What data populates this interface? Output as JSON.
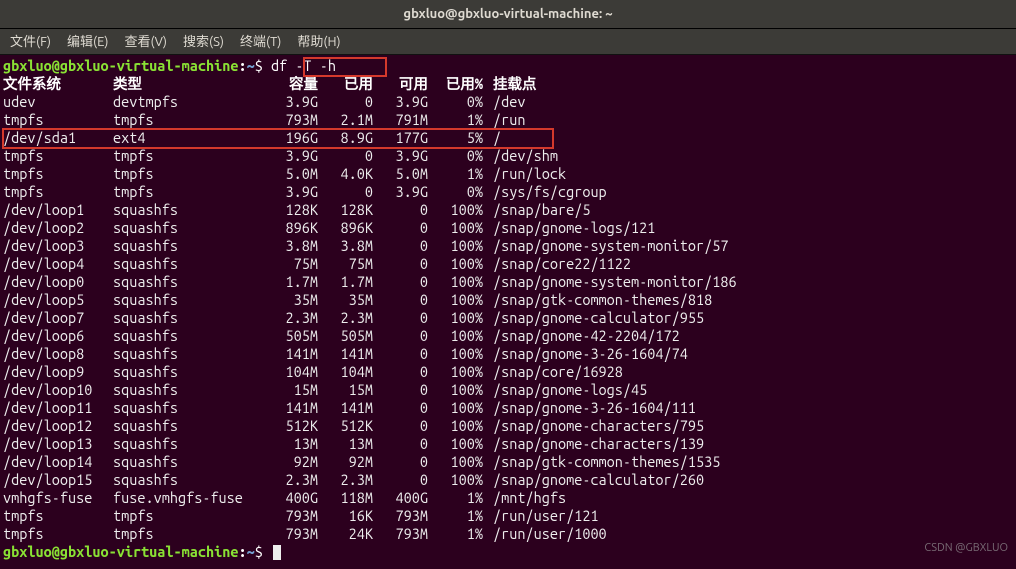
{
  "title": "gbxluo@gbxluo-virtual-machine: ~",
  "menu": [
    "文件(F)",
    "编辑(E)",
    "查看(V)",
    "搜索(S)",
    "终端(T)",
    "帮助(H)"
  ],
  "prompt": {
    "user": "gbxluo",
    "host": "gbxluo-virtual-machine",
    "path": "~",
    "symbol": "$"
  },
  "command": "df -T -h",
  "headers": {
    "fs": "文件系统",
    "type": "类型",
    "size": "容量",
    "used": "已用",
    "avail": "可用",
    "pct": "已用%",
    "mnt": "挂载点"
  },
  "rows": [
    {
      "fs": "udev",
      "type": "devtmpfs",
      "size": "3.9G",
      "used": "0",
      "avail": "3.9G",
      "pct": "0%",
      "mnt": "/dev"
    },
    {
      "fs": "tmpfs",
      "type": "tmpfs",
      "size": "793M",
      "used": "2.1M",
      "avail": "791M",
      "pct": "1%",
      "mnt": "/run"
    },
    {
      "fs": "/dev/sda1",
      "type": "ext4",
      "size": "196G",
      "used": "8.9G",
      "avail": "177G",
      "pct": "5%",
      "mnt": "/"
    },
    {
      "fs": "tmpfs",
      "type": "tmpfs",
      "size": "3.9G",
      "used": "0",
      "avail": "3.9G",
      "pct": "0%",
      "mnt": "/dev/shm"
    },
    {
      "fs": "tmpfs",
      "type": "tmpfs",
      "size": "5.0M",
      "used": "4.0K",
      "avail": "5.0M",
      "pct": "1%",
      "mnt": "/run/lock"
    },
    {
      "fs": "tmpfs",
      "type": "tmpfs",
      "size": "3.9G",
      "used": "0",
      "avail": "3.9G",
      "pct": "0%",
      "mnt": "/sys/fs/cgroup"
    },
    {
      "fs": "/dev/loop1",
      "type": "squashfs",
      "size": "128K",
      "used": "128K",
      "avail": "0",
      "pct": "100%",
      "mnt": "/snap/bare/5"
    },
    {
      "fs": "/dev/loop2",
      "type": "squashfs",
      "size": "896K",
      "used": "896K",
      "avail": "0",
      "pct": "100%",
      "mnt": "/snap/gnome-logs/121"
    },
    {
      "fs": "/dev/loop3",
      "type": "squashfs",
      "size": "3.8M",
      "used": "3.8M",
      "avail": "0",
      "pct": "100%",
      "mnt": "/snap/gnome-system-monitor/57"
    },
    {
      "fs": "/dev/loop4",
      "type": "squashfs",
      "size": "75M",
      "used": "75M",
      "avail": "0",
      "pct": "100%",
      "mnt": "/snap/core22/1122"
    },
    {
      "fs": "/dev/loop0",
      "type": "squashfs",
      "size": "1.7M",
      "used": "1.7M",
      "avail": "0",
      "pct": "100%",
      "mnt": "/snap/gnome-system-monitor/186"
    },
    {
      "fs": "/dev/loop5",
      "type": "squashfs",
      "size": "35M",
      "used": "35M",
      "avail": "0",
      "pct": "100%",
      "mnt": "/snap/gtk-common-themes/818"
    },
    {
      "fs": "/dev/loop7",
      "type": "squashfs",
      "size": "2.3M",
      "used": "2.3M",
      "avail": "0",
      "pct": "100%",
      "mnt": "/snap/gnome-calculator/955"
    },
    {
      "fs": "/dev/loop6",
      "type": "squashfs",
      "size": "505M",
      "used": "505M",
      "avail": "0",
      "pct": "100%",
      "mnt": "/snap/gnome-42-2204/172"
    },
    {
      "fs": "/dev/loop8",
      "type": "squashfs",
      "size": "141M",
      "used": "141M",
      "avail": "0",
      "pct": "100%",
      "mnt": "/snap/gnome-3-26-1604/74"
    },
    {
      "fs": "/dev/loop9",
      "type": "squashfs",
      "size": "104M",
      "used": "104M",
      "avail": "0",
      "pct": "100%",
      "mnt": "/snap/core/16928"
    },
    {
      "fs": "/dev/loop10",
      "type": "squashfs",
      "size": "15M",
      "used": "15M",
      "avail": "0",
      "pct": "100%",
      "mnt": "/snap/gnome-logs/45"
    },
    {
      "fs": "/dev/loop11",
      "type": "squashfs",
      "size": "141M",
      "used": "141M",
      "avail": "0",
      "pct": "100%",
      "mnt": "/snap/gnome-3-26-1604/111"
    },
    {
      "fs": "/dev/loop12",
      "type": "squashfs",
      "size": "512K",
      "used": "512K",
      "avail": "0",
      "pct": "100%",
      "mnt": "/snap/gnome-characters/795"
    },
    {
      "fs": "/dev/loop13",
      "type": "squashfs",
      "size": "13M",
      "used": "13M",
      "avail": "0",
      "pct": "100%",
      "mnt": "/snap/gnome-characters/139"
    },
    {
      "fs": "/dev/loop14",
      "type": "squashfs",
      "size": "92M",
      "used": "92M",
      "avail": "0",
      "pct": "100%",
      "mnt": "/snap/gtk-common-themes/1535"
    },
    {
      "fs": "/dev/loop15",
      "type": "squashfs",
      "size": "2.3M",
      "used": "2.3M",
      "avail": "0",
      "pct": "100%",
      "mnt": "/snap/gnome-calculator/260"
    },
    {
      "fs": "vmhgfs-fuse",
      "type": "fuse.vmhgfs-fuse",
      "size": "400G",
      "used": "118M",
      "avail": "400G",
      "pct": "1%",
      "mnt": "/mnt/hgfs"
    },
    {
      "fs": "tmpfs",
      "type": "tmpfs",
      "size": "793M",
      "used": "16K",
      "avail": "793M",
      "pct": "1%",
      "mnt": "/run/user/121"
    },
    {
      "fs": "tmpfs",
      "type": "tmpfs",
      "size": "793M",
      "used": "24K",
      "avail": "793M",
      "pct": "1%",
      "mnt": "/run/user/1000"
    }
  ],
  "watermark": "CSDN @GBXLUO"
}
